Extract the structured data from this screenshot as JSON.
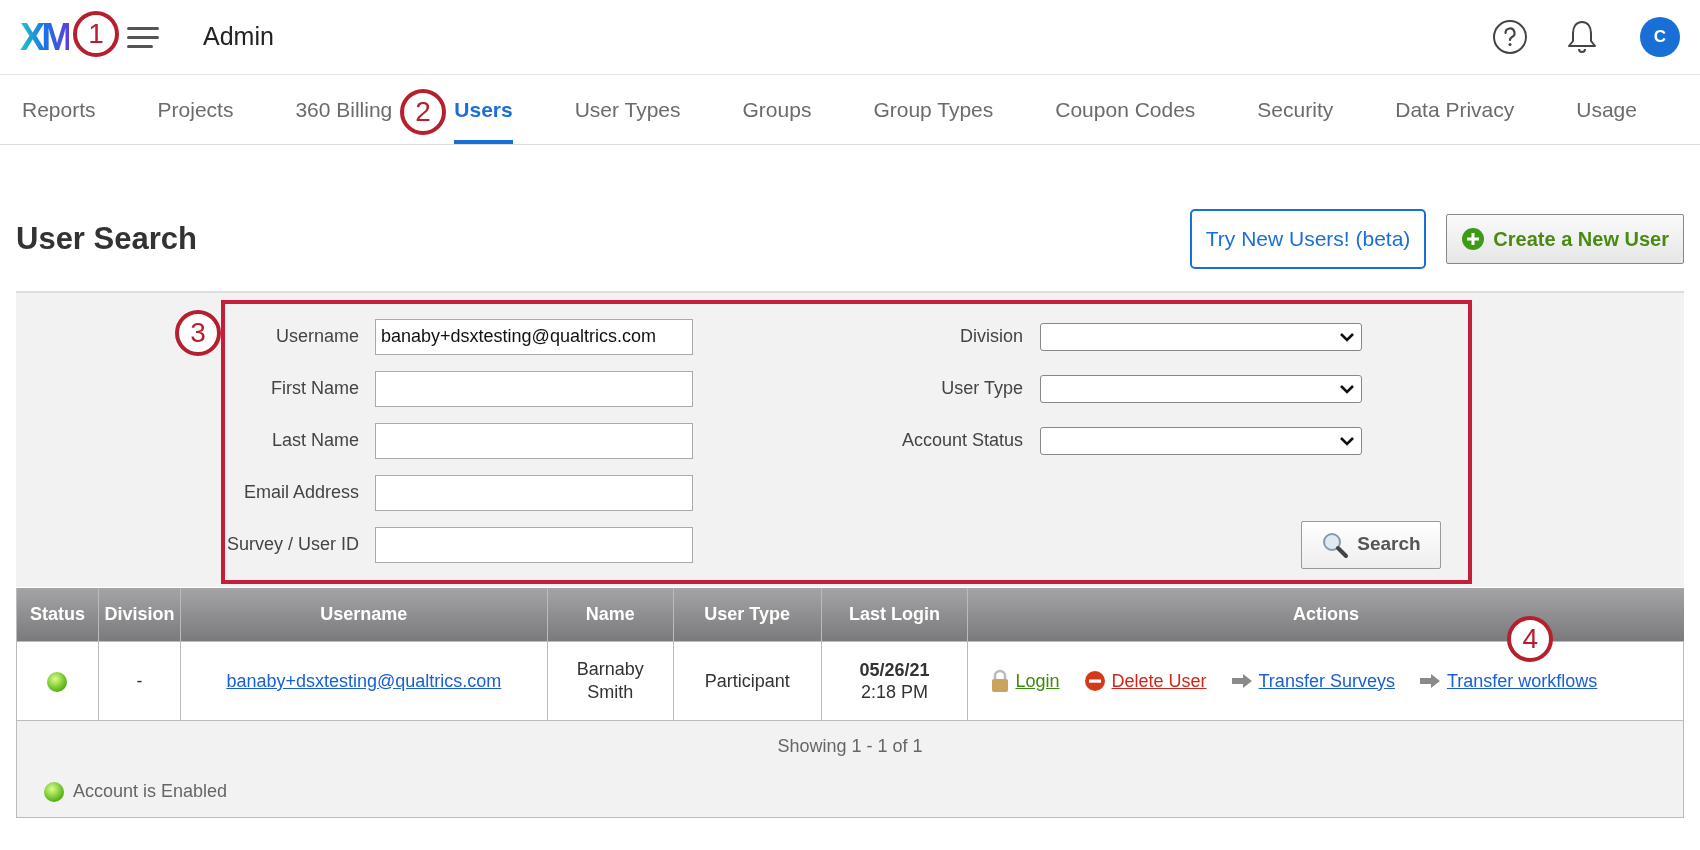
{
  "header": {
    "logo": "XM",
    "title": "Admin",
    "avatar": "C"
  },
  "tabs": [
    {
      "label": "Reports",
      "selected": false
    },
    {
      "label": "Projects",
      "selected": false
    },
    {
      "label": "360 Billing",
      "selected": false
    },
    {
      "label": "Users",
      "selected": true
    },
    {
      "label": "User Types",
      "selected": false
    },
    {
      "label": "Groups",
      "selected": false
    },
    {
      "label": "Group Types",
      "selected": false
    },
    {
      "label": "Coupon Codes",
      "selected": false
    },
    {
      "label": "Security",
      "selected": false
    },
    {
      "label": "Data Privacy",
      "selected": false
    },
    {
      "label": "Usage",
      "selected": false
    }
  ],
  "page_title": "User Search",
  "buttons": [
    {
      "kind": "outline",
      "label": "Try New Users! (beta)"
    },
    {
      "kind": "create",
      "label": "Create a New User"
    }
  ],
  "search_form": {
    "fields": [
      {
        "label": "Username",
        "value": "banaby+dsxtesting@qualtrics.com"
      },
      {
        "label": "First Name"
      },
      {
        "label": "Last Name"
      },
      {
        "label": "Email Address"
      },
      {
        "label": "Survey / User ID"
      }
    ],
    "selects": [
      {
        "label": "Division"
      },
      {
        "label": "User Type"
      },
      {
        "label": "Account Status"
      }
    ],
    "search_button": "Search"
  },
  "table": {
    "columns": [
      "Status",
      "Division",
      "Username",
      "Name",
      "User Type",
      "Last Login",
      "Actions"
    ],
    "rows": [
      {
        "enabled": true,
        "division": "-",
        "username": "banaby+dsxtesting@qualtrics.com",
        "name": "Barnaby Smith",
        "user_type": "Participant",
        "last_login_date": "05/26/21",
        "last_login_time": "2:18 PM",
        "actions": [
          {
            "kind": "login",
            "label": "Login"
          },
          {
            "kind": "delete",
            "label": "Delete User"
          },
          {
            "kind": "transfer",
            "label": "Transfer Surveys"
          },
          {
            "kind": "transfer",
            "label": "Transfer workflows"
          }
        ]
      }
    ],
    "summary": "Showing 1 - 1 of 1",
    "legend": "Account is Enabled"
  },
  "callouts": [
    "1",
    "2",
    "3",
    "4"
  ]
}
